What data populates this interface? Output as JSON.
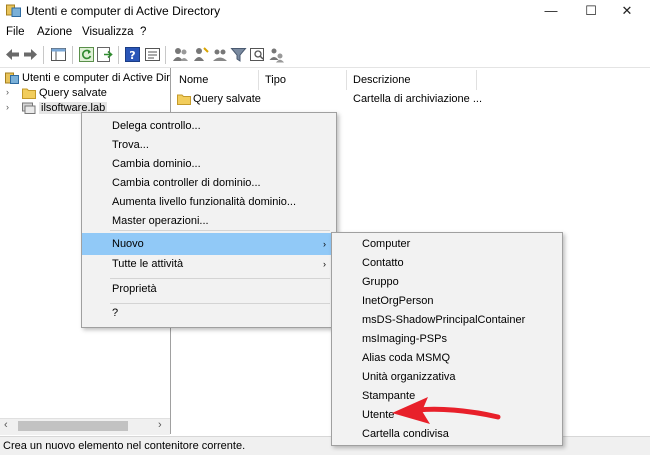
{
  "window": {
    "title": "Utenti e computer di Active Directory",
    "minimize_glyph": "—",
    "maximize_glyph": "☐",
    "close_glyph": "✕"
  },
  "menubar": [
    "File",
    "Azione",
    "Visualizza",
    "?"
  ],
  "toolbar": {
    "icons": [
      "back-arrow-icon",
      "forward-arrow-icon",
      "show-console-tree-icon",
      "refresh-icon",
      "export-list-icon",
      "help-icon",
      "properties-icon",
      "users-icon",
      "new-user-icon",
      "new-group-icon",
      "filter-icon",
      "find-icon",
      "add-to-group-icon"
    ]
  },
  "tree": {
    "root": "Utenti e computer di Active Directory",
    "items": [
      {
        "label": "Query salvate",
        "icon": "folder-icon"
      },
      {
        "label": "ilsoftware.lab",
        "icon": "domain-icon"
      }
    ]
  },
  "list": {
    "columns": [
      "Nome",
      "Tipo",
      "Descrizione"
    ],
    "rows": [
      {
        "name": "Query salvate",
        "type": "",
        "description": "Cartella di archiviazione ..."
      }
    ]
  },
  "context_menu": {
    "items": [
      {
        "label": "Delega controllo..."
      },
      {
        "label": "Trova..."
      },
      {
        "label": "Cambia dominio..."
      },
      {
        "label": "Cambia controller di dominio..."
      },
      {
        "label": "Aumenta livello funzionalità dominio..."
      },
      {
        "label": "Master operazioni..."
      },
      {
        "label": "Nuovo",
        "submenu": true,
        "highlighted": true
      },
      {
        "label": "Tutte le attività",
        "submenu": true
      },
      {
        "label": "Proprietà"
      },
      {
        "label": "?"
      }
    ],
    "arrow_glyph": "›"
  },
  "submenu": {
    "items": [
      "Computer",
      "Contatto",
      "Gruppo",
      "InetOrgPerson",
      "msDS-ShadowPrincipalContainer",
      "msImaging-PSPs",
      "Alias coda MSMQ",
      "Unità organizzativa",
      "Stampante",
      "Utente",
      "Cartella condivisa"
    ]
  },
  "statusbar": {
    "text": "Crea un nuovo elemento nel contenitore corrente."
  },
  "scroll": {
    "left_glyph": "‹",
    "right_glyph": "›"
  },
  "colors": {
    "highlight": "#91c9f7",
    "annotation_arrow": "#e8202a",
    "menu_bg": "#f2f2f2"
  }
}
